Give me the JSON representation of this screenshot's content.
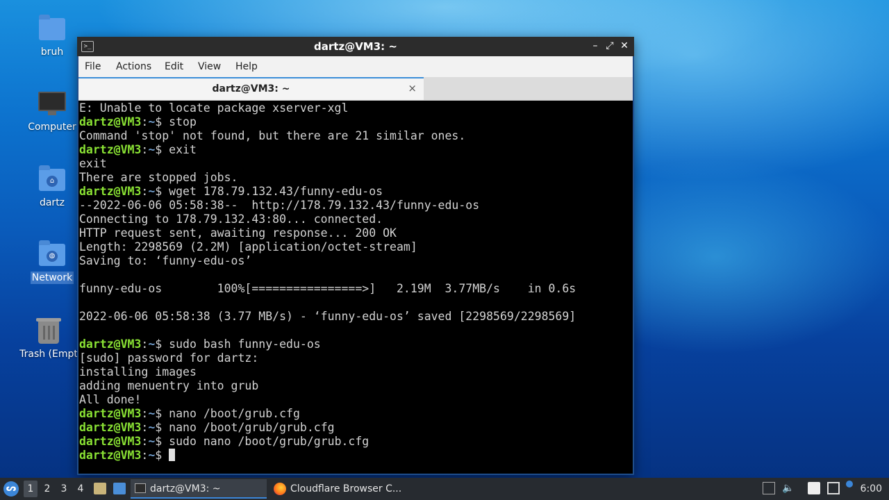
{
  "desktop": {
    "icons": [
      {
        "label": "bruh"
      },
      {
        "label": "Computer"
      },
      {
        "label": "dartz"
      },
      {
        "label": "Network"
      },
      {
        "label": "Trash (Empt"
      }
    ]
  },
  "window": {
    "title": "dartz@VM3: ~",
    "controls": {
      "minimize": "–",
      "maximize": "⤢",
      "close": "✕"
    },
    "menu": [
      "File",
      "Actions",
      "Edit",
      "View",
      "Help"
    ],
    "tab": {
      "title": "dartz@VM3: ~",
      "close": "×"
    }
  },
  "prompt": {
    "user": "dartz@VM3",
    "sep": ":",
    "path": "~",
    "symbol": "$ "
  },
  "terminal": [
    {
      "text": "E: Unable to locate package xserver-xgl"
    },
    {
      "cmd": "stop"
    },
    {
      "text": "Command 'stop' not found, but there are 21 similar ones."
    },
    {
      "cmd": "exit"
    },
    {
      "text": "exit"
    },
    {
      "text": "There are stopped jobs."
    },
    {
      "cmd": "wget 178.79.132.43/funny-edu-os"
    },
    {
      "text": "--2022-06-06 05:58:38--  http://178.79.132.43/funny-edu-os"
    },
    {
      "text": "Connecting to 178.79.132.43:80... connected."
    },
    {
      "text": "HTTP request sent, awaiting response... 200 OK"
    },
    {
      "text": "Length: 2298569 (2.2M) [application/octet-stream]"
    },
    {
      "text": "Saving to: ‘funny-edu-os’"
    },
    {
      "text": ""
    },
    {
      "text": "funny-edu-os        100%[================>]   2.19M  3.77MB/s    in 0.6s"
    },
    {
      "text": ""
    },
    {
      "text": "2022-06-06 05:58:38 (3.77 MB/s) - ‘funny-edu-os’ saved [2298569/2298569]"
    },
    {
      "text": ""
    },
    {
      "cmd": "sudo bash funny-edu-os"
    },
    {
      "text": "[sudo] password for dartz:"
    },
    {
      "text": "installing images"
    },
    {
      "text": "adding menuentry into grub"
    },
    {
      "text": "All done!"
    },
    {
      "cmd": "nano /boot/grub.cfg"
    },
    {
      "cmd": "nano /boot/grub/grub.cfg"
    },
    {
      "cmd": "sudo nano /boot/grub/grub.cfg"
    },
    {
      "cmd": "",
      "cursor": true
    }
  ],
  "taskbar": {
    "start_glyph": "ᔕ",
    "workspaces": [
      "1",
      "2",
      "3",
      "4"
    ],
    "active_workspace": "1",
    "tasks": [
      {
        "label": "dartz@VM3: ~",
        "icon": "terminal-icon",
        "active": true
      },
      {
        "label": "Cloudflare Browser C...",
        "icon": "firefox-icon",
        "active": false
      }
    ],
    "clock": "6:00"
  },
  "colors": {
    "prompt_user": "#8ae234",
    "prompt_path": "#729fcf",
    "terminal_bg": "#000000",
    "terminal_fg": "#d3d3d3",
    "accent": "#3b86d8"
  }
}
